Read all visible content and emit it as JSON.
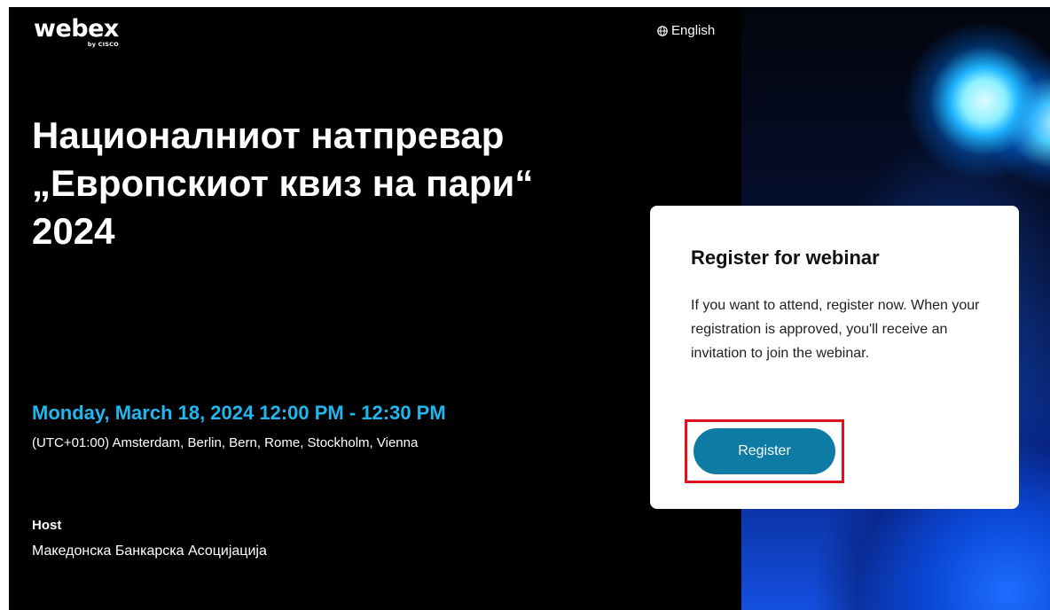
{
  "brand": {
    "logo_text": "webex",
    "logo_sub": "by CISCO"
  },
  "header": {
    "language_label": "English"
  },
  "event": {
    "title": "Националниот натпревар „Европскиот квиз на пари“ 2024",
    "datetime": "Monday, March 18, 2024 12:00 PM - 12:30 PM",
    "timezone": "(UTC+01:00) Amsterdam, Berlin, Bern, Rome, Stockholm, Vienna",
    "host_label": "Host",
    "host_name": "Македонска Банкарска Асоцијација"
  },
  "registration": {
    "heading": "Register for webinar",
    "description": "If you want to attend, register now. When your registration is approved, you'll receive an invitation to join the webinar.",
    "button_label": "Register"
  },
  "colors": {
    "accent_date": "#20b7ef",
    "button": "#0d7ba4",
    "highlight": "#e0121b",
    "background": "#000000"
  },
  "icons": {
    "language": "globe-icon"
  }
}
